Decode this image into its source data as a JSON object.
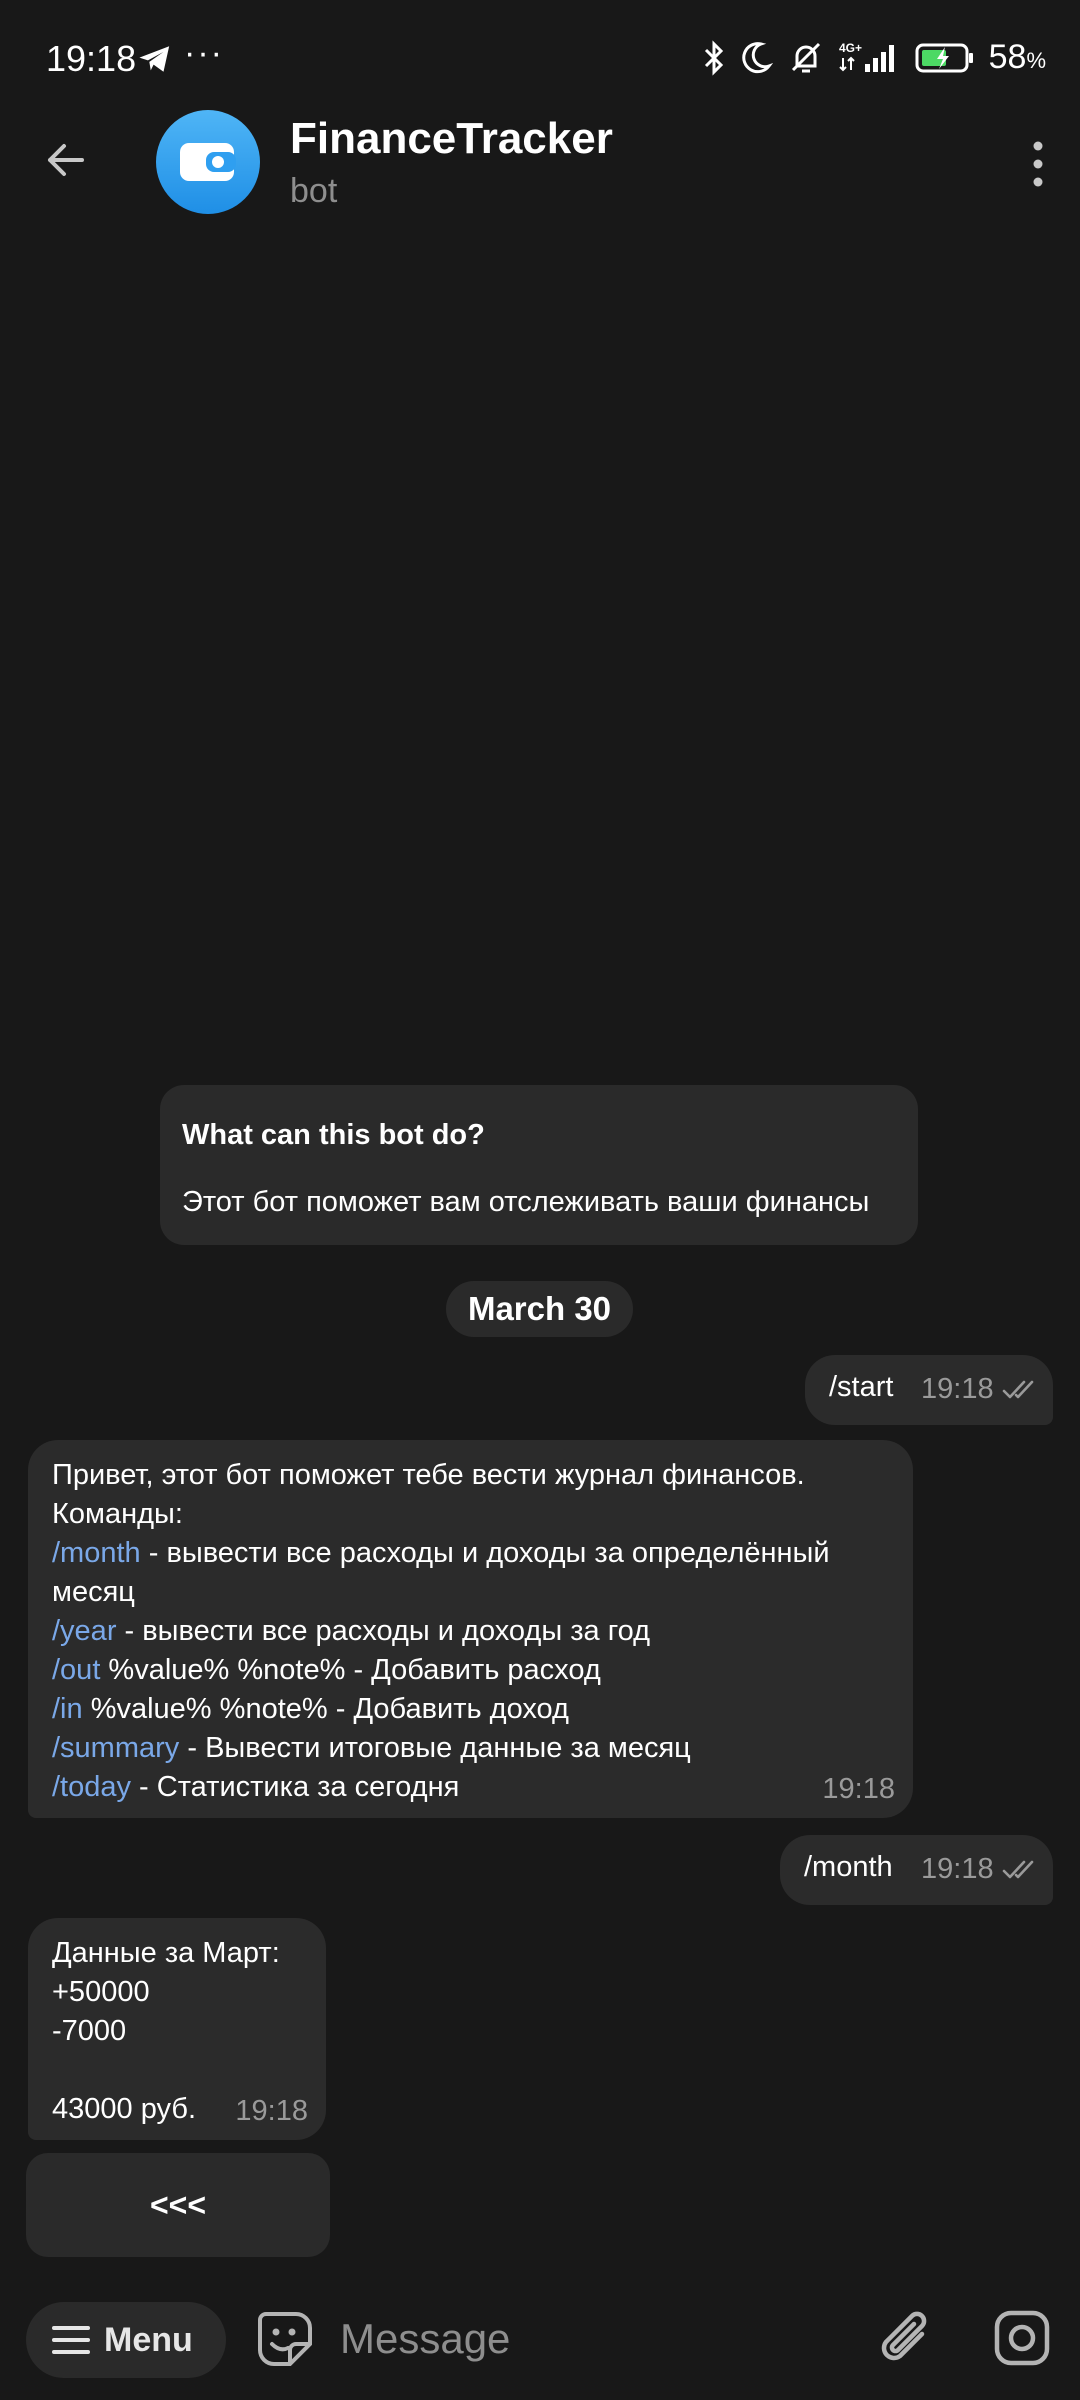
{
  "status_bar": {
    "time": "19:18",
    "more": "···",
    "battery_percent": "58",
    "battery_unit": "%",
    "network_label": "4G+"
  },
  "header": {
    "title": "FinanceTracker",
    "subtitle": "bot"
  },
  "bot_info": {
    "title": "What can this bot do?",
    "text": "Этот бот поможет вам отслеживать ваши финансы"
  },
  "date_chip": "March 30",
  "messages": {
    "start": {
      "text": "/start",
      "time": "19:18"
    },
    "help": {
      "line1": "Привет, этот бот поможет тебе вести журнал финансов.",
      "line2": "Команды:",
      "cmd_month": "/month",
      "desc_month": " - вывести все расходы и доходы за определённый месяц",
      "cmd_year": "/year",
      "desc_year": " - вывести все расходы и доходы за год",
      "cmd_out": "/out",
      "desc_out": " %value% %note% - Добавить расход",
      "cmd_in": "/in",
      "desc_in": " %value% %note% - Добавить доход",
      "cmd_summary": "/summary",
      "desc_summary": " - Вывести итоговые данные за месяц",
      "cmd_today": "/today",
      "desc_today": " - Статистика за сегодня",
      "time": "19:18"
    },
    "month": {
      "text": "/month",
      "time": "19:18"
    },
    "data": {
      "line1": "Данные за Март:",
      "line2": "+50000",
      "line3": "-7000",
      "line4": "43000 руб.",
      "time": "19:18"
    }
  },
  "inline_button": {
    "label": "<<<"
  },
  "input_bar": {
    "menu_label": "Menu",
    "placeholder": "Message"
  },
  "colors": {
    "background": "#181818",
    "bubble": "#2b2b2b",
    "command_link": "#7aa8e8",
    "avatar": "#2f9ff0"
  }
}
